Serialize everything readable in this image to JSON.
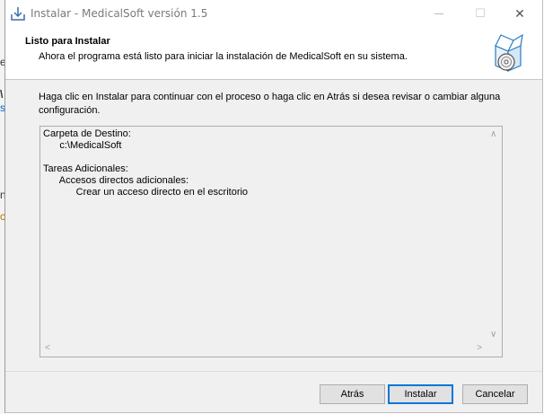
{
  "window": {
    "title": "Instalar - MedicalSoft versión 1.5",
    "controls": {
      "minimize": "—",
      "maximize": "☐",
      "close": "✕"
    }
  },
  "header": {
    "title": "Listo para Instalar",
    "subtitle": "Ahora el programa está listo para iniciar la instalación de MedicalSoft en su sistema."
  },
  "body": {
    "instructions": "Haga clic en Instalar para continuar con el proceso o haga clic en Atrás si desea revisar o cambiar alguna configuración."
  },
  "memo": {
    "lines": [
      "Carpeta de Destino:",
      "      c:\\MedicalSoft",
      "",
      "Tareas Adicionales:",
      "      Accesos directos adicionales:",
      "            Crear un acceso directo en el escritorio"
    ]
  },
  "buttons": {
    "back": "Atrás",
    "install": "Instalar",
    "cancel": "Cancelar"
  },
  "icons": {
    "app": "installer-download-icon",
    "header": "setup-box-cd-icon"
  }
}
